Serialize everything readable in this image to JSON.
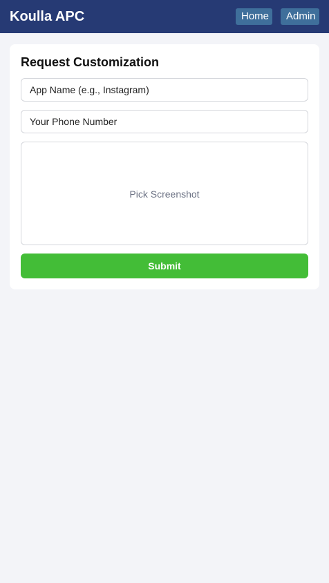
{
  "header": {
    "brand": "Koulla APC",
    "nav": {
      "home_label": "Home",
      "admin_label": "Admin"
    }
  },
  "form": {
    "title": "Request Customization",
    "app_name": {
      "placeholder": "App Name (e.g., Instagram)",
      "value": ""
    },
    "phone": {
      "placeholder": "Your Phone Number",
      "value": ""
    },
    "screenshot_picker_label": "Pick Screenshot",
    "submit_label": "Submit"
  },
  "colors": {
    "header_bg": "#263a74",
    "nav_button_bg": "#3f6f9b",
    "submit_bg": "#43bd37",
    "page_bg": "#f3f4f8"
  }
}
